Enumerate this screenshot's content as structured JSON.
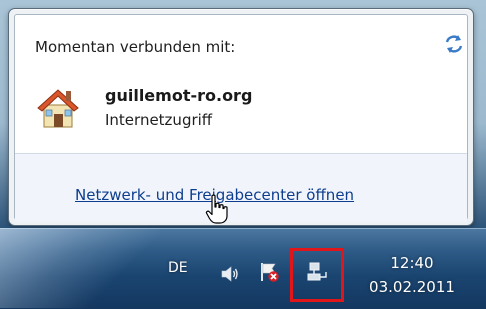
{
  "popup": {
    "heading": "Momentan verbunden mit:",
    "network_name": "guillemot-ro.org",
    "network_status": "Internetzugriff",
    "link_label": "Netzwerk- und Freigabecenter öffnen",
    "icons": {
      "refresh": "refresh-icon",
      "network": "house-network-icon",
      "cursor": "hand-pointer-icon"
    }
  },
  "taskbar": {
    "language": "DE",
    "time": "12:40",
    "date": "03.02.2011",
    "tray_icons": [
      "speaker-icon",
      "action-center-flag-icon",
      "network-icon"
    ]
  },
  "colors": {
    "link": "#0d3d8f",
    "highlight_box": "#e0161b",
    "taskbar": "#1a4470"
  }
}
